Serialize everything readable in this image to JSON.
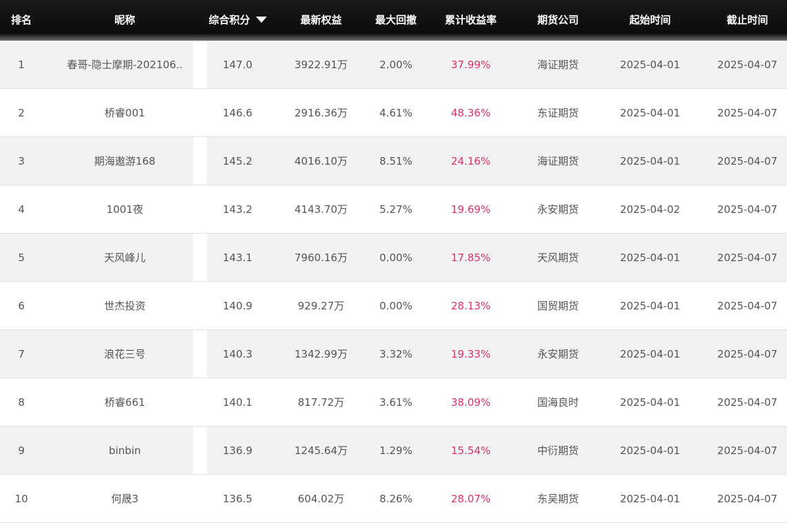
{
  "headers": {
    "rank": "排名",
    "nickname": "昵称",
    "score": "综合积分",
    "equity": "最新权益",
    "max_drawdown": "最大回撤",
    "cum_return": "累计收益率",
    "broker": "期货公司",
    "start": "起始时间",
    "end": "截止时间"
  },
  "sort": {
    "column": "score",
    "direction": "desc",
    "icon": "caret-down-icon"
  },
  "colors": {
    "header_bg": "#0b0b0b",
    "return_text": "#d6336c",
    "stripe": "#f2f2f2"
  },
  "rows": [
    {
      "rank": "1",
      "nickname": "春哥-隐士摩期-202106..",
      "score": "147.0",
      "equity": "3922.91万",
      "max_drawdown": "2.00%",
      "cum_return": "37.99%",
      "broker": "海证期货",
      "start": "2025-04-01",
      "end": "2025-04-07"
    },
    {
      "rank": "2",
      "nickname": "桥睿001",
      "score": "146.6",
      "equity": "2916.36万",
      "max_drawdown": "4.61%",
      "cum_return": "48.36%",
      "broker": "东证期货",
      "start": "2025-04-01",
      "end": "2025-04-07"
    },
    {
      "rank": "3",
      "nickname": "期海遨游168",
      "score": "145.2",
      "equity": "4016.10万",
      "max_drawdown": "8.51%",
      "cum_return": "24.16%",
      "broker": "海证期货",
      "start": "2025-04-01",
      "end": "2025-04-07"
    },
    {
      "rank": "4",
      "nickname": "1001夜",
      "score": "143.2",
      "equity": "4143.70万",
      "max_drawdown": "5.27%",
      "cum_return": "19.69%",
      "broker": "永安期货",
      "start": "2025-04-02",
      "end": "2025-04-07"
    },
    {
      "rank": "5",
      "nickname": "天风峰儿",
      "score": "143.1",
      "equity": "7960.16万",
      "max_drawdown": "0.00%",
      "cum_return": "17.85%",
      "broker": "天风期货",
      "start": "2025-04-01",
      "end": "2025-04-07"
    },
    {
      "rank": "6",
      "nickname": "世杰投资",
      "score": "140.9",
      "equity": "929.27万",
      "max_drawdown": "0.00%",
      "cum_return": "28.13%",
      "broker": "国贸期货",
      "start": "2025-04-01",
      "end": "2025-04-07"
    },
    {
      "rank": "7",
      "nickname": "浪花三号",
      "score": "140.3",
      "equity": "1342.99万",
      "max_drawdown": "3.32%",
      "cum_return": "19.33%",
      "broker": "永安期货",
      "start": "2025-04-01",
      "end": "2025-04-07"
    },
    {
      "rank": "8",
      "nickname": "桥睿661",
      "score": "140.1",
      "equity": "817.72万",
      "max_drawdown": "3.61%",
      "cum_return": "38.09%",
      "broker": "国海良时",
      "start": "2025-04-01",
      "end": "2025-04-07"
    },
    {
      "rank": "9",
      "nickname": "binbin",
      "score": "136.9",
      "equity": "1245.64万",
      "max_drawdown": "1.29%",
      "cum_return": "15.54%",
      "broker": "中衍期货",
      "start": "2025-04-01",
      "end": "2025-04-07"
    },
    {
      "rank": "10",
      "nickname": "何晟3",
      "score": "136.5",
      "equity": "604.02万",
      "max_drawdown": "8.26%",
      "cum_return": "28.07%",
      "broker": "东吴期货",
      "start": "2025-04-01",
      "end": "2025-04-07"
    }
  ]
}
